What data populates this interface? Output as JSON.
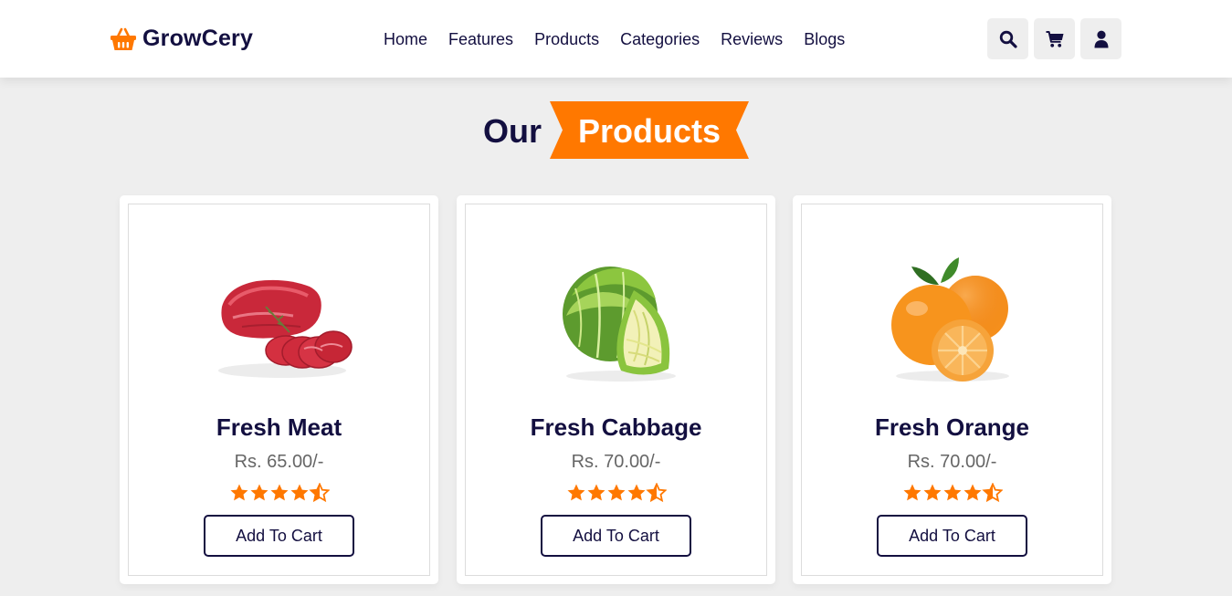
{
  "header": {
    "logo_text": "GrowCery",
    "logo_icon": "basket-icon",
    "nav": [
      "Home",
      "Features",
      "Products",
      "Categories",
      "Reviews",
      "Blogs"
    ],
    "icons": [
      "search-icon",
      "cart-icon",
      "user-icon"
    ]
  },
  "heading": {
    "part1": "Our",
    "part2": "Products"
  },
  "colors": {
    "accent": "#ff7800",
    "text": "#130f40",
    "background": "#eeeeee"
  },
  "products": [
    {
      "name": "Fresh Meat",
      "price": "Rs. 65.00/-",
      "rating": 4.5,
      "button": "Add To Cart",
      "image": "meat-image"
    },
    {
      "name": "Fresh Cabbage",
      "price": "Rs. 70.00/-",
      "rating": 4.5,
      "button": "Add To Cart",
      "image": "cabbage-image"
    },
    {
      "name": "Fresh Orange",
      "price": "Rs. 70.00/-",
      "rating": 4.5,
      "button": "Add To Cart",
      "image": "orange-image"
    }
  ]
}
